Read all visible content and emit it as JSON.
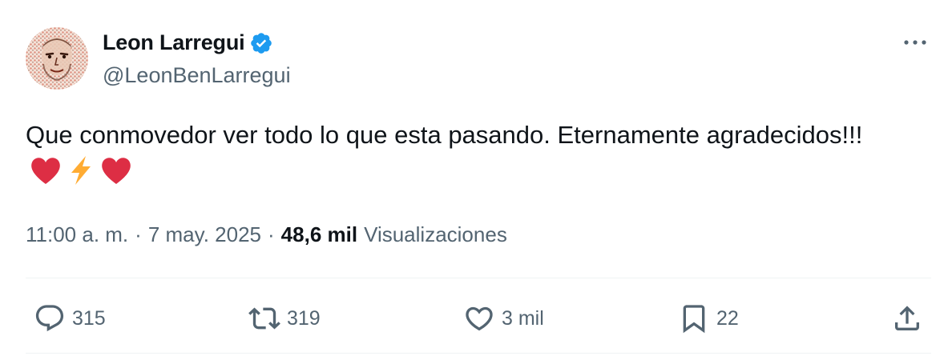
{
  "author": {
    "display_name": "Leon Larregui",
    "handle": "@LeonBenLarregui",
    "verified": true,
    "avatar_icon": "portrait-illustration-avatar"
  },
  "tweet": {
    "text": "Que conmovedor ver todo lo que esta pasando. Eternamente agradecidos!!!",
    "emojis": [
      "red-heart",
      "high-voltage",
      "red-heart"
    ]
  },
  "meta": {
    "time": "11:00 a. m.",
    "separator": "·",
    "date": "7 may. 2025",
    "views_count": "48,6 mil",
    "views_label": "Visualizaciones"
  },
  "actions": {
    "replies": "315",
    "retweets": "319",
    "likes": "3 mil",
    "bookmarks": "22"
  },
  "colors": {
    "text_primary": "#0f1419",
    "text_secondary": "#536471",
    "verified_blue": "#1d9bf0",
    "divider": "#eff3f4",
    "heart_red": "#dd2e44",
    "bolt_yellow": "#ffac33"
  }
}
